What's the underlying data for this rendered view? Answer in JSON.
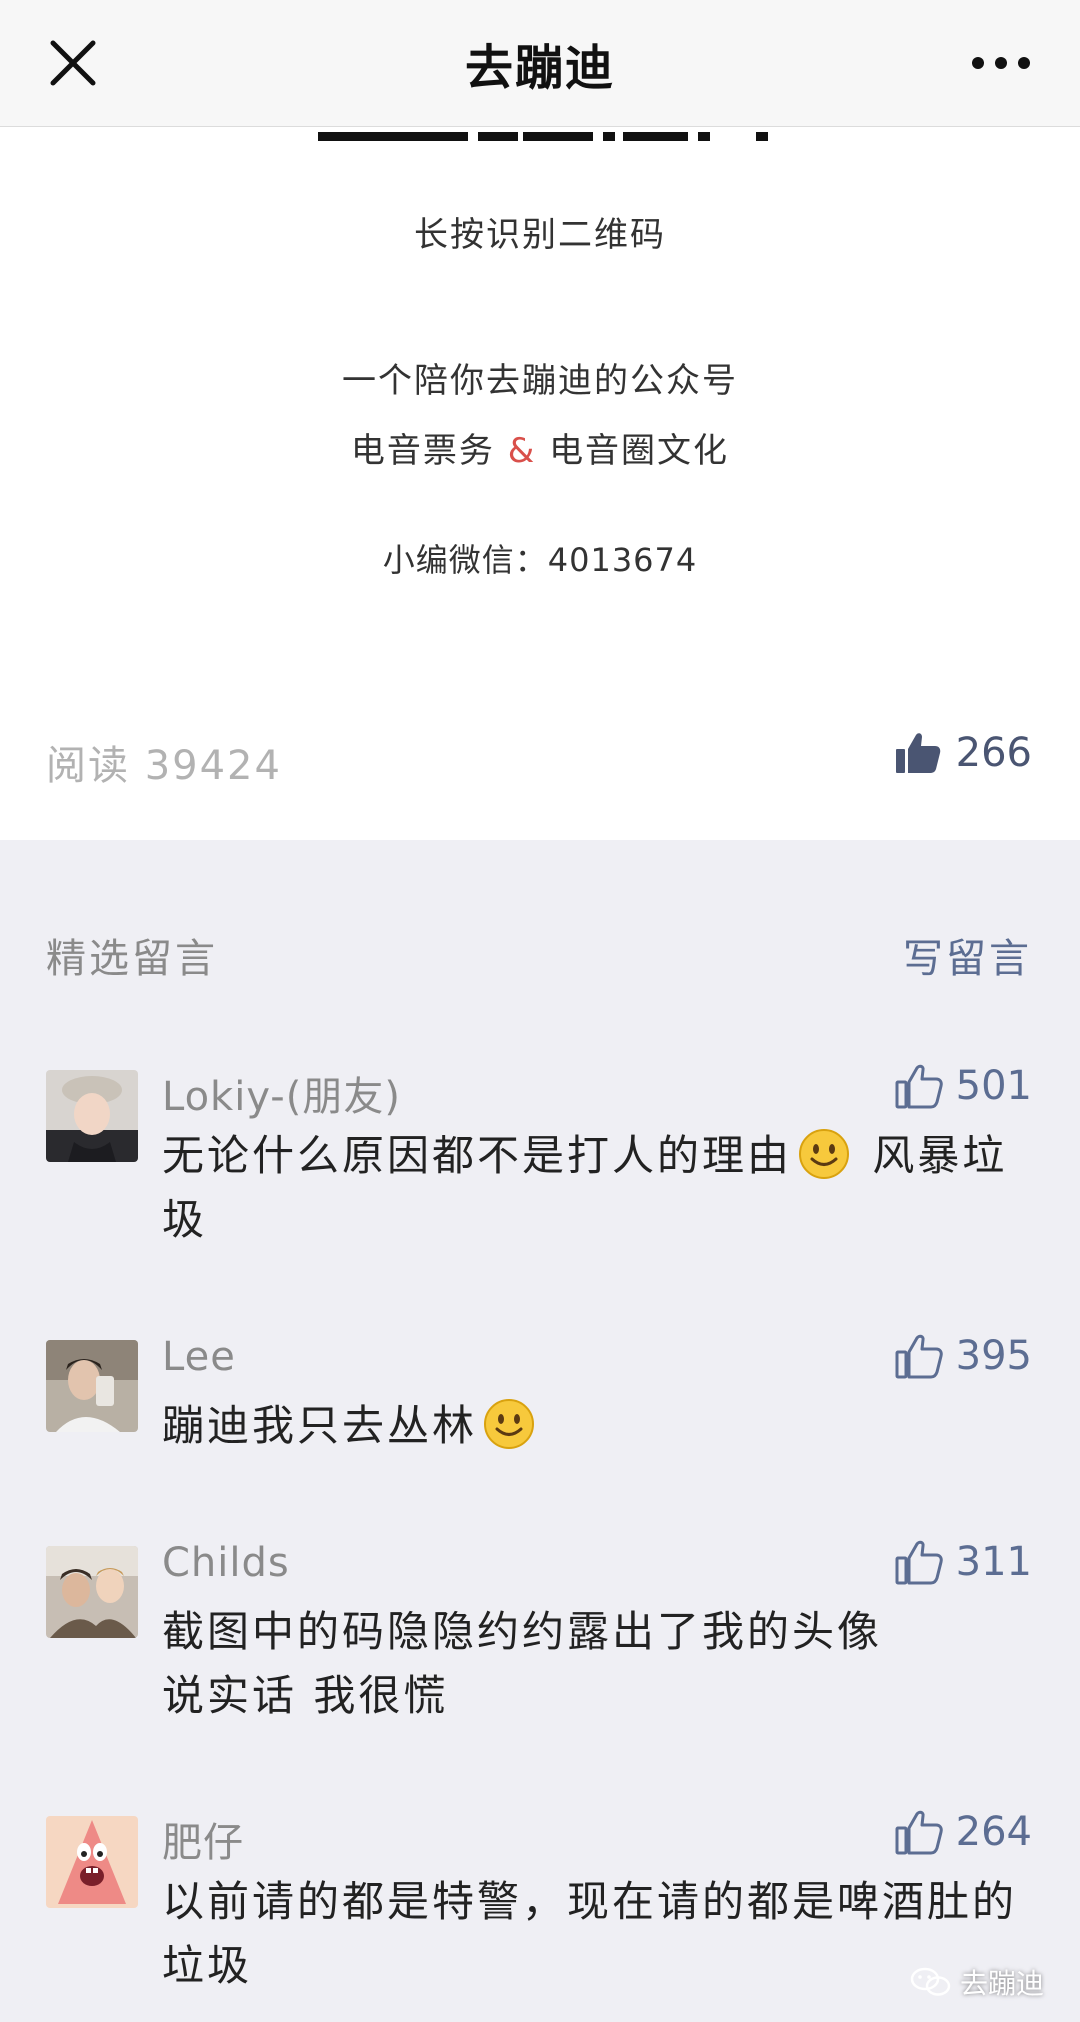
{
  "navbar": {
    "title": "去蹦迪",
    "close_icon": "close-icon",
    "more_icon": "more-dots-icon"
  },
  "article": {
    "qr_hint": "长按识别二维码",
    "intro": "一个陪你去蹦迪的公众号",
    "tags_left": "电音票务",
    "tags_amp": "&",
    "tags_right": "电音圈文化",
    "wechat_contact": "小编微信：4013674",
    "read_count": "阅读 39424",
    "like_count": "266"
  },
  "comments_section": {
    "title": "精选留言",
    "write_button": "写留言",
    "items": [
      {
        "name": "Lokiy-(朋友)",
        "likes": "501",
        "text_before": "无论什么原因都不是打人的理由",
        "text_after": " 风暴垃圾"
      },
      {
        "name": "Lee",
        "likes": "395",
        "text_before": "蹦迪我只去丛林",
        "text_after": ""
      },
      {
        "name": "Childs",
        "likes": "311",
        "line1": "截图中的码隐隐约约露出了我的头像",
        "line2": "说实话 我很慌"
      },
      {
        "name": "肥仔",
        "likes": "264",
        "text": "以前请的都是特警，现在请的都是啤酒肚的垃圾"
      }
    ]
  },
  "watermark": "去蹦迪",
  "colors": {
    "accent_blue": "#5c6d92",
    "amp_red": "#d9504b",
    "comment_bg": "#efeff4"
  }
}
